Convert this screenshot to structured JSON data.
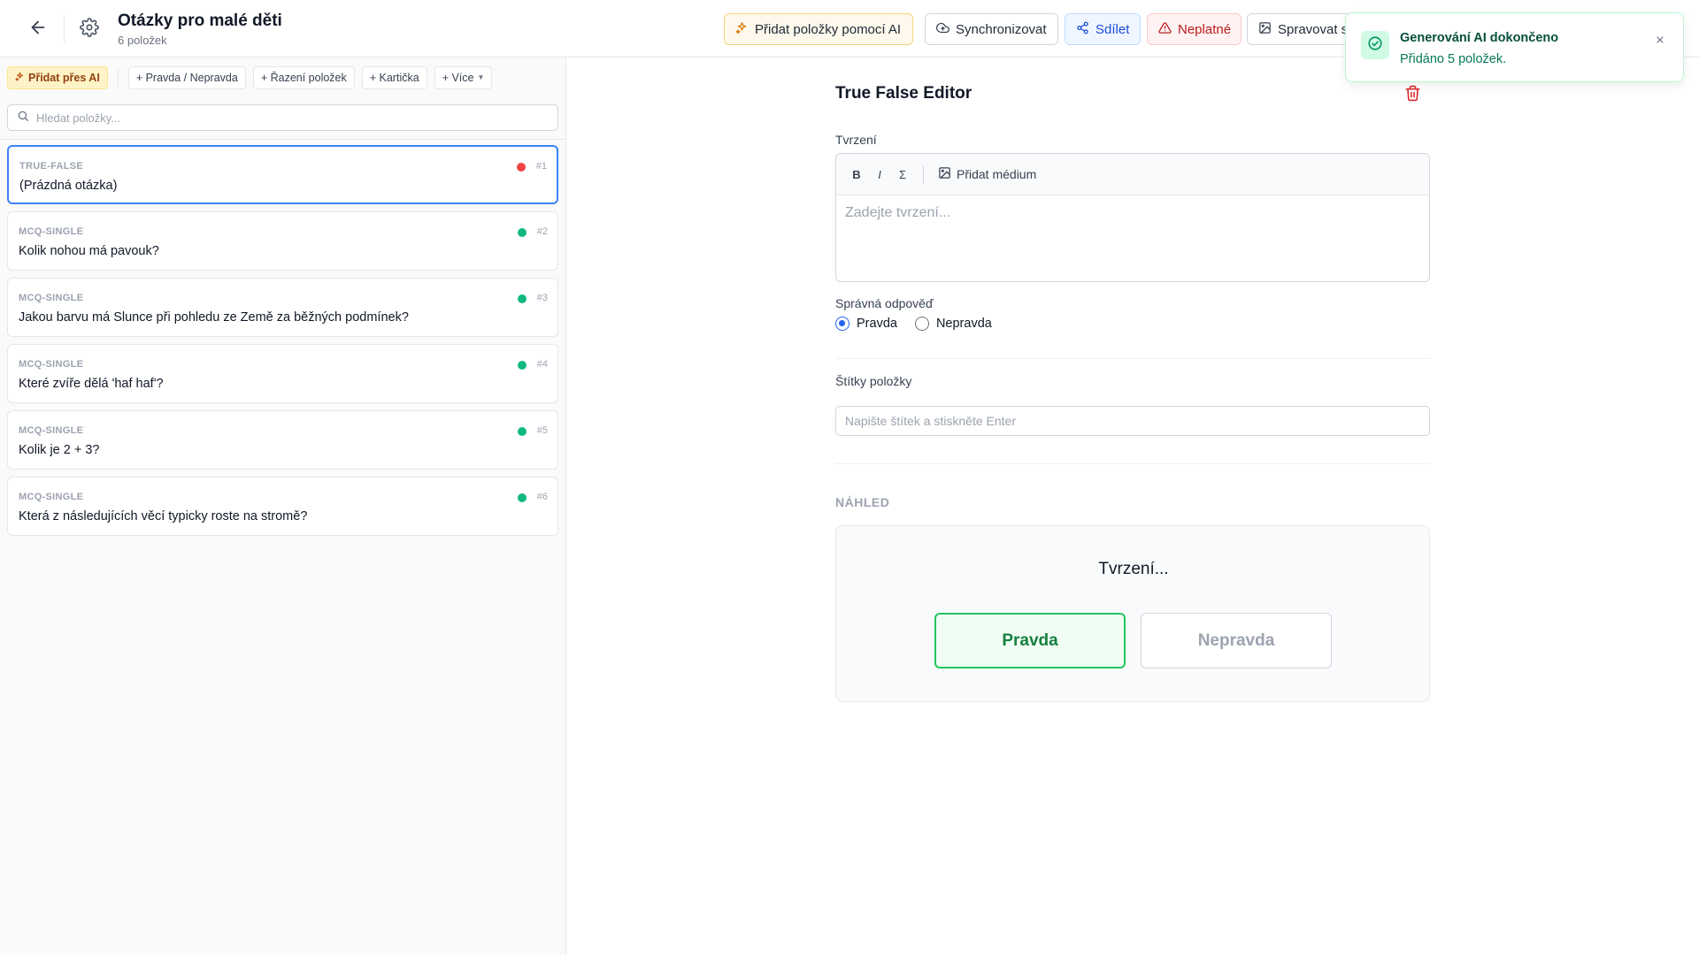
{
  "header": {
    "title": "Otázky pro malé děti",
    "subtitle": "6 položek",
    "buttons": {
      "ai": "Přidat položky pomocí AI",
      "sync": "Synchronizovat",
      "share": "Sdílet",
      "invalid": "Neplatné",
      "manage": "Spravovat s"
    }
  },
  "sidebar": {
    "quick_add": {
      "ai": "Přidat přes AI",
      "true_false": "+ Pravda / Nepravda",
      "ordering": "+ Řazení položek",
      "flashcard": "+ Kartička",
      "more": "+ Více"
    },
    "search": {
      "placeholder": "Hledat položky..."
    },
    "items": [
      {
        "type": "TRUE-FALSE",
        "text": "(Prázdná otázka)",
        "num": "#1",
        "status_color": "#ef4444",
        "selected": true
      },
      {
        "type": "MCQ-SINGLE",
        "text": "Kolik nohou má pavouk?",
        "num": "#2",
        "status_color": "#10b981",
        "selected": false
      },
      {
        "type": "MCQ-SINGLE",
        "text": "Jakou barvu má Slunce při pohledu ze Země za běžných podmínek?",
        "num": "#3",
        "status_color": "#10b981",
        "selected": false
      },
      {
        "type": "MCQ-SINGLE",
        "text": "Které zvíře dělá 'haf haf'?",
        "num": "#4",
        "status_color": "#10b981",
        "selected": false
      },
      {
        "type": "MCQ-SINGLE",
        "text": "Kolik je 2 + 3?",
        "num": "#5",
        "status_color": "#10b981",
        "selected": false
      },
      {
        "type": "MCQ-SINGLE",
        "text": "Která z následujících věcí typicky roste na stromě?",
        "num": "#6",
        "status_color": "#10b981",
        "selected": false
      }
    ]
  },
  "editor": {
    "title": "True False Editor",
    "statement_label": "Tvrzení",
    "toolbar": {
      "bold": "B",
      "italic": "I",
      "math": "Σ",
      "media": "Přidat médium"
    },
    "statement_placeholder": "Zadejte tvrzení...",
    "answer_label": "Správná odpověď",
    "options": {
      "true": "Pravda",
      "false": "Nepravda"
    },
    "selected_answer": "true",
    "tags_label": "Štítky položky",
    "tags_placeholder": "Napište štítek a stiskněte Enter",
    "preview_label": "NÁHLED",
    "preview_statement": "Tvrzení...",
    "preview_true": "Pravda",
    "preview_false": "Nepravda"
  },
  "toast": {
    "title": "Generování AI dokončeno",
    "message": "Přidáno 5 položek."
  },
  "colors": {
    "accent": "#3b82f6",
    "success": "#10b981",
    "error": "#ef4444"
  }
}
